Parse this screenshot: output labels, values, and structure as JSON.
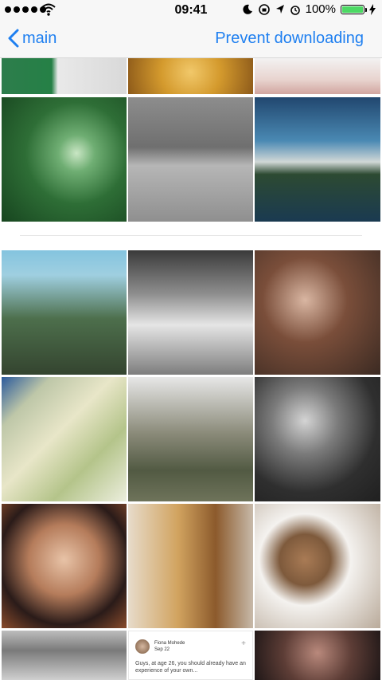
{
  "status_bar": {
    "time": "09:41",
    "battery": "100%",
    "icons": [
      "signal-dots-icon",
      "wifi-icon",
      "moon-icon",
      "orientation-lock-icon",
      "location-arrow-icon",
      "alarm-icon",
      "battery-icon",
      "charging-bolt-icon"
    ]
  },
  "nav": {
    "back_label": "main",
    "right_action_label": "Prevent downloading"
  },
  "tweet_card": {
    "author": "Fiona Mohede",
    "handle": "Sep 22",
    "text": "Guys, at age 26, you should already have an experience of your own..."
  },
  "colors": {
    "accent": "#1e7ff0",
    "battery_fill": "#4cd964"
  }
}
